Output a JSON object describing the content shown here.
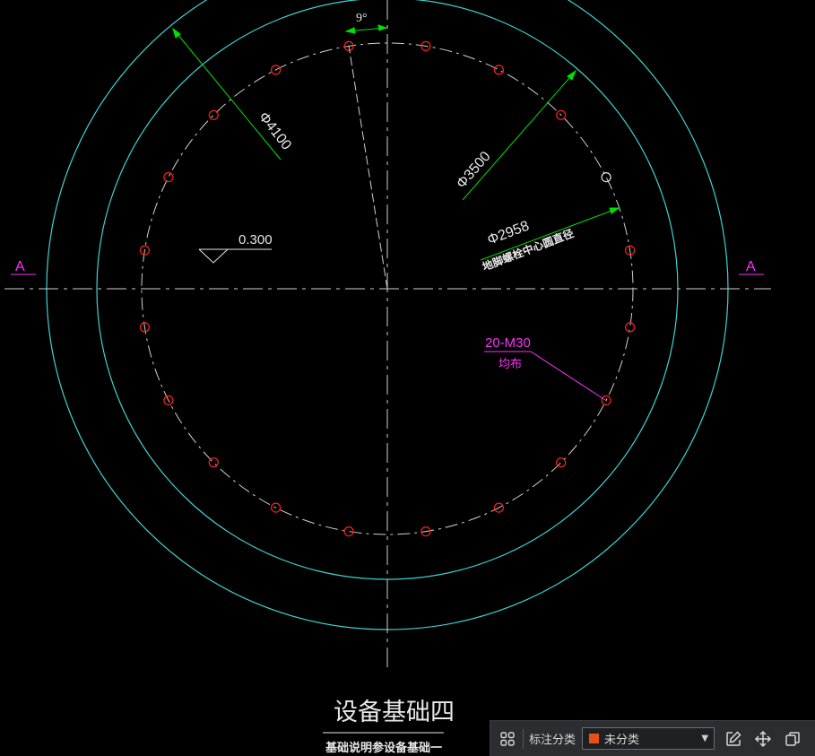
{
  "drawing": {
    "angle_label": "9°",
    "outer_diameter_label": "Φ4100",
    "bolt_outer_diameter_label": "Φ3500",
    "bolt_center_diameter_label": "Φ2958",
    "bolt_center_note": "地脚螺栓中心圆直径",
    "elevation_label": "0.300",
    "section_left_label": "A",
    "section_right_label": "A",
    "bolt_spec_label": "20-M30",
    "bolt_spec_note": "均布",
    "title": "设备基础四",
    "subtitle": "基础说明参设备基础一",
    "colors": {
      "outer_circle": "#3fd3d3",
      "dimension": "#00e000",
      "bolt_hole": "#ff2020",
      "annotation": "#ff30ff",
      "text": "#e8e8e8",
      "centerline": "#d0d0d0"
    }
  },
  "toolbar": {
    "layout_icon": "grid-icon",
    "category_label": "标注分类",
    "category_value": "未分类",
    "category_color": "#e8501a",
    "tools": [
      "edit-icon",
      "move-icon",
      "copy-icon"
    ]
  }
}
